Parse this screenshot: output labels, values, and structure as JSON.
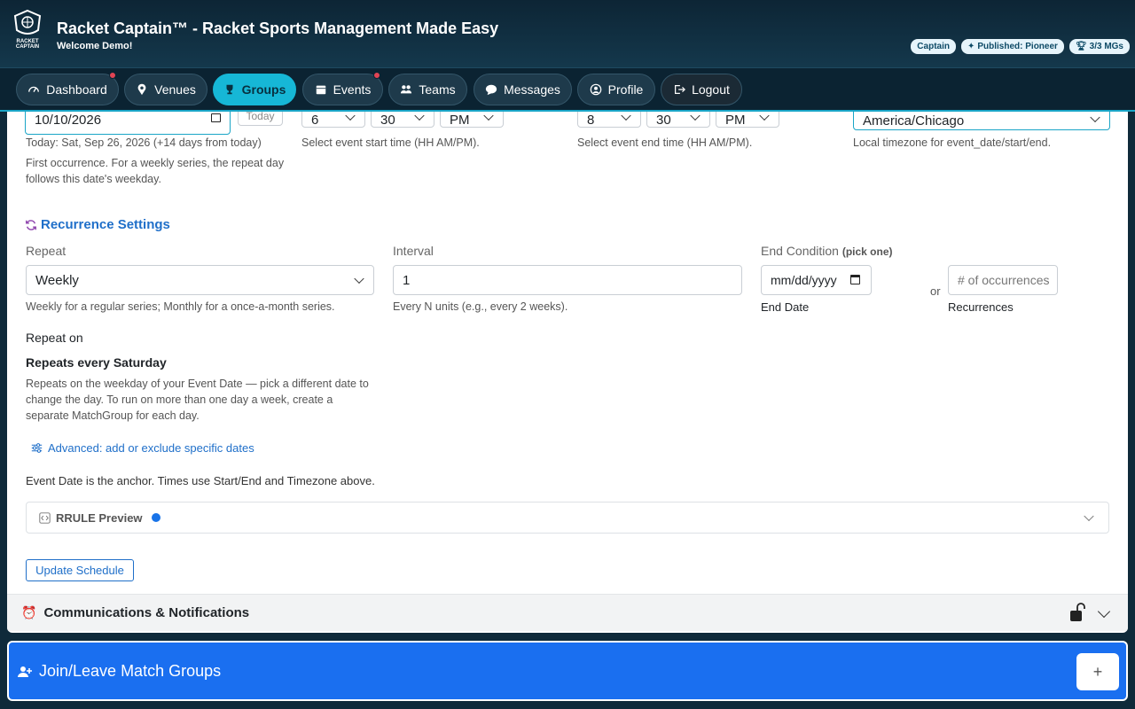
{
  "header": {
    "title": "Racket Captain™ - Racket Sports Management Made Easy",
    "welcome": "Welcome Demo!",
    "logo_text": "RACKET CAPTAIN",
    "badges": [
      "Captain",
      "Published: Pioneer",
      "3/3 MGs"
    ]
  },
  "nav": {
    "items": [
      {
        "label": "Dashboard",
        "icon": "gauge-icon"
      },
      {
        "label": "Venues",
        "icon": "map-pin-icon"
      },
      {
        "label": "Groups",
        "icon": "trophy-icon"
      },
      {
        "label": "Events",
        "icon": "calendar-icon"
      },
      {
        "label": "Teams",
        "icon": "people-icon"
      },
      {
        "label": "Messages",
        "icon": "chat-icon"
      },
      {
        "label": "Profile",
        "icon": "person-circle-icon"
      },
      {
        "label": "Logout",
        "icon": "logout-icon"
      }
    ]
  },
  "event": {
    "date_value": "10/10/2026",
    "today_button": "Today",
    "today_text": "Today: Sat, Sep 26, 2026 (+14 days from today)",
    "date_help": "First occurrence. For a weekly series, the repeat day follows this date's weekday.",
    "start_hour": "6",
    "start_min": "30",
    "start_ampm": "PM",
    "start_help": "Select event start time (HH AM/PM).",
    "end_hour": "8",
    "end_min": "30",
    "end_ampm": "PM",
    "end_help": "Select event end time (HH AM/PM).",
    "timezone": "America/Chicago",
    "timezone_help": "Local timezone for event_date/start/end."
  },
  "recurrence": {
    "title": "Recurrence Settings",
    "repeat_label": "Repeat",
    "repeat_value": "Weekly",
    "repeat_help": "Weekly for a regular series; Monthly for a once-a-month series.",
    "interval_label": "Interval",
    "interval_value": "1",
    "interval_help": "Every N units (e.g., every 2 weeks).",
    "end_label": "End Condition",
    "end_label_note": "(pick one)",
    "end_date_placeholder": "mm/dd/yyyy",
    "end_date_label": "End Date",
    "or_text": "or",
    "occurrences_placeholder": "# of occurrences",
    "occurrences_label": "Recurrences",
    "repeat_on_label": "Repeat on",
    "repeats_every": "Repeats every Saturday",
    "repeats_help": "Repeats on the weekday of your Event Date — pick a different date to change the day. To run on more than one day a week, create a separate MatchGroup for each day.",
    "advanced_link": "Advanced: add or exclude specific dates",
    "anchor_note": "Event Date is the anchor. Times use Start/End and Timezone above.",
    "rrule_preview": "RRULE Preview",
    "update_button": "Update Schedule"
  },
  "communications": {
    "title": "Communications & Notifications"
  },
  "join": {
    "title": "Join/Leave Match Groups",
    "plus": "+"
  },
  "colors": {
    "accent": "#16b7d6",
    "brand_blue": "#1a6ff0",
    "link": "#1f6fc9",
    "notify": "#e14454"
  }
}
